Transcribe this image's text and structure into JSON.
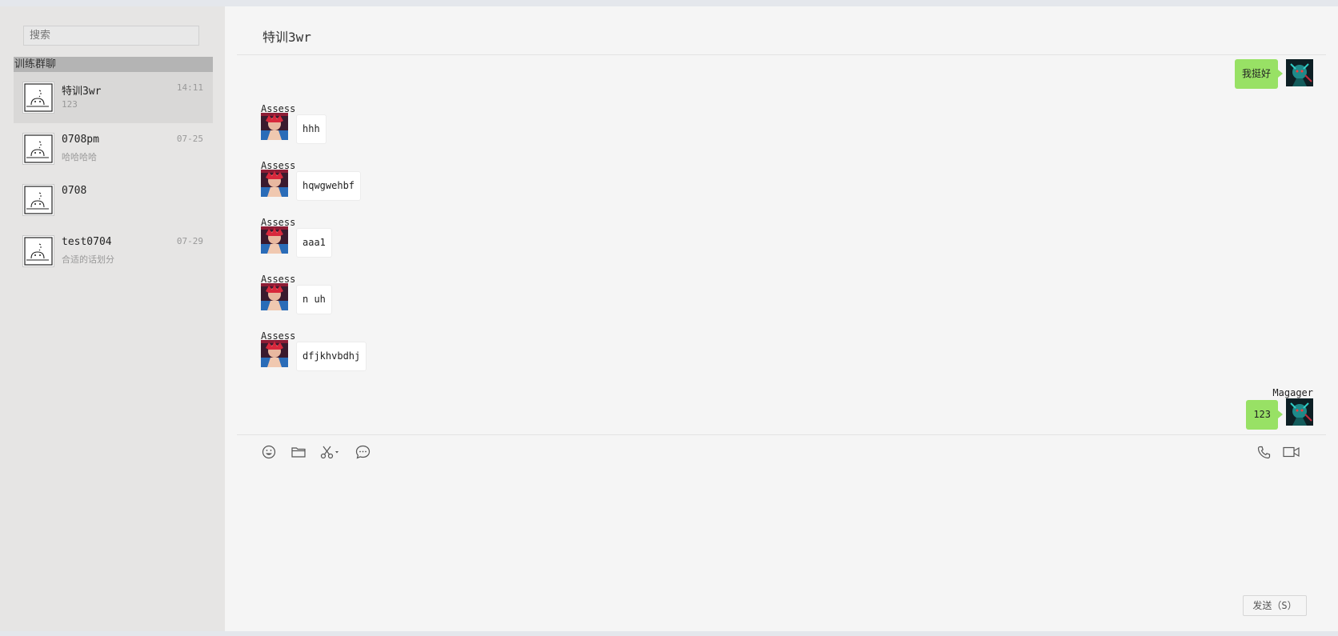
{
  "sidebar": {
    "search_placeholder": "搜索",
    "group_label": "训练群聊",
    "conversations": [
      {
        "name": "特训3wr",
        "preview": "123",
        "time": "14:11",
        "active": true
      },
      {
        "name": "0708pm",
        "preview": "哈哈哈哈",
        "time": "07-25",
        "active": false
      },
      {
        "name": "0708",
        "preview": "",
        "time": "",
        "active": false
      },
      {
        "name": "test0704",
        "preview": "合适的话划分",
        "time": "07-29",
        "active": false
      }
    ]
  },
  "chat": {
    "title": "特训3wr",
    "messages": [
      {
        "side": "right",
        "sender": "",
        "text": "我挺好"
      },
      {
        "side": "left",
        "sender": "Assess",
        "text": "hhh"
      },
      {
        "side": "left",
        "sender": "Assess",
        "text": "hqwgwehbf"
      },
      {
        "side": "left",
        "sender": "Assess",
        "text": "aaa1"
      },
      {
        "side": "left",
        "sender": "Assess",
        "text": "n uh"
      },
      {
        "side": "left",
        "sender": "Assess",
        "text": "dfjkhvbdhj"
      },
      {
        "side": "right",
        "sender": "Magager",
        "text": "123"
      }
    ]
  },
  "toolbar": {
    "icons": [
      "emoji-icon",
      "folder-icon",
      "scissors-icon",
      "chat-bubble-icon",
      "phone-icon",
      "video-icon"
    ]
  },
  "composer": {
    "input_value": "",
    "send_label": "发送（S）"
  }
}
